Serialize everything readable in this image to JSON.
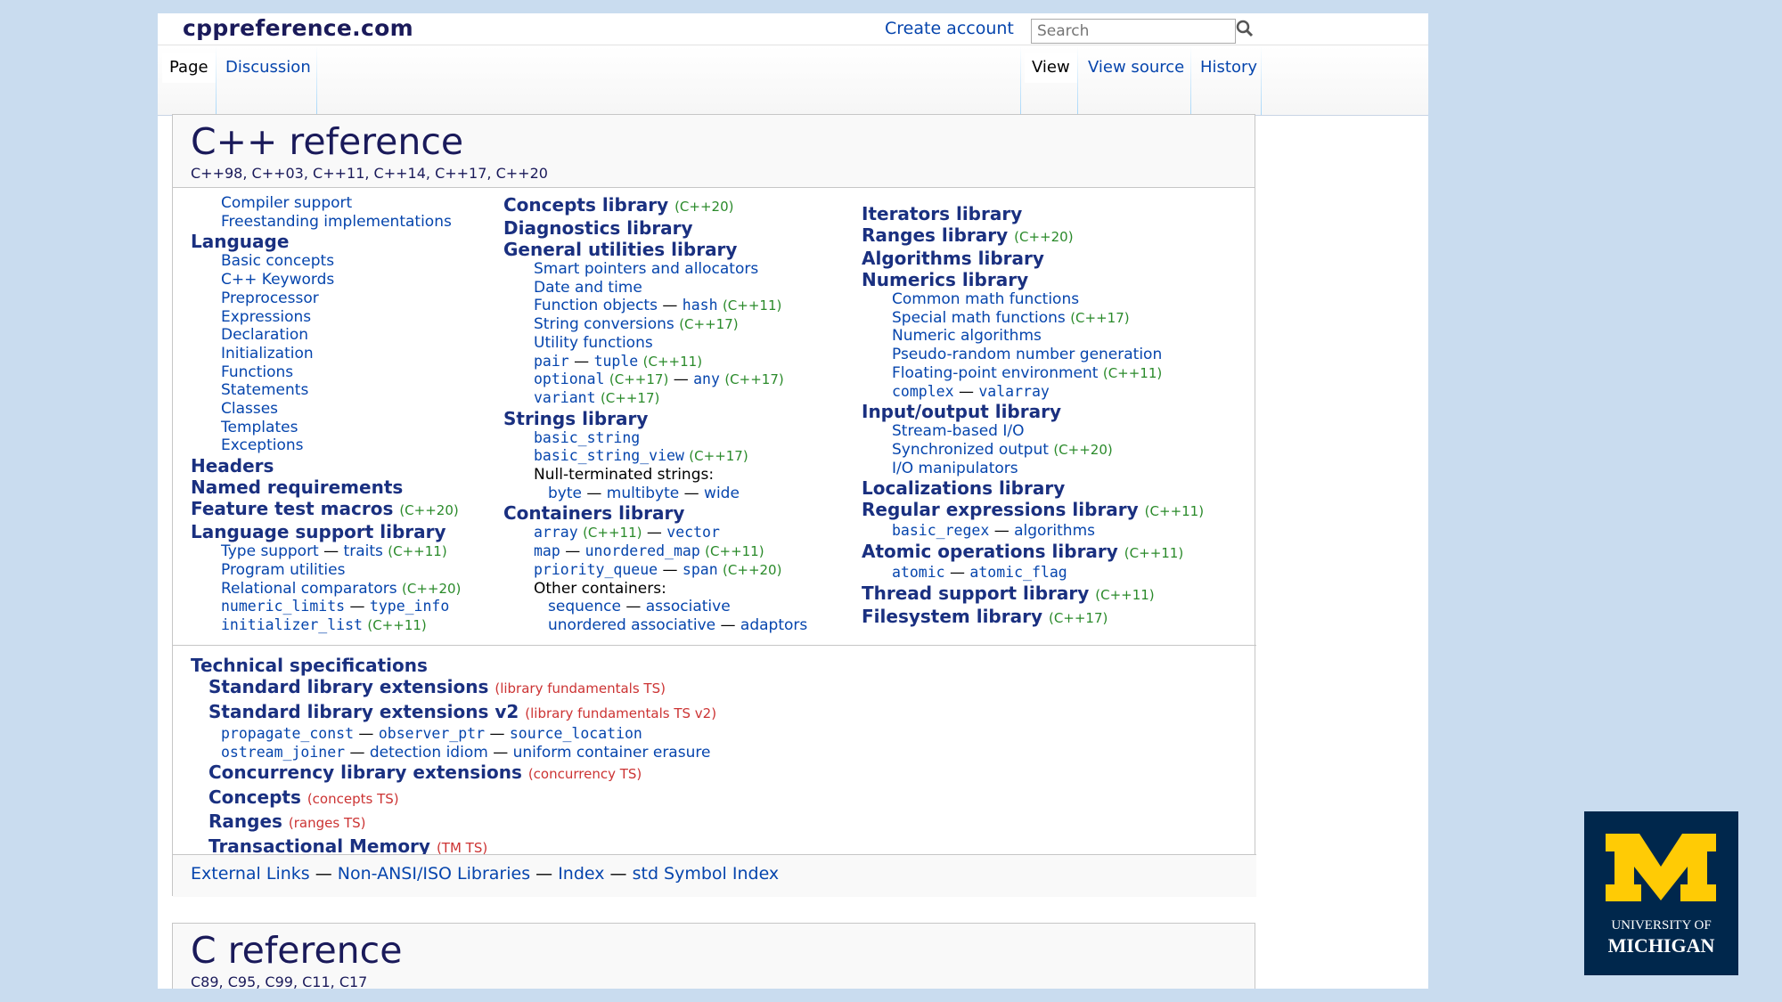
{
  "site": {
    "logo": "cppreference.com",
    "create_account": "Create account",
    "search_placeholder": "Search"
  },
  "tabs": {
    "page": "Page",
    "discussion": "Discussion",
    "view": "View",
    "view_source": "View source",
    "history": "History"
  },
  "cpp": {
    "title": "C++ reference",
    "versions": "C++98, C++03, C++11, C++14, C++17, C++20"
  },
  "col1": {
    "compiler_support": "Compiler support",
    "freestanding": "Freestanding implementations",
    "language": "Language",
    "language_items": [
      "Basic concepts",
      "C++ Keywords",
      "Preprocessor",
      "Expressions",
      "Declaration",
      "Initialization",
      "Functions",
      "Statements",
      "Classes",
      "Templates",
      "Exceptions"
    ],
    "headers": "Headers",
    "named_requirements": "Named requirements",
    "feature_test": "Feature test macros",
    "feature_test_ver": "(C++20)",
    "lang_support": "Language support library",
    "type_support": "Type support",
    "traits": "traits",
    "traits_ver": "(C++11)",
    "program_utilities": "Program utilities",
    "relational": "Relational comparators",
    "relational_ver": "(C++20)",
    "numeric_limits": "numeric_limits",
    "type_info": "type_info",
    "initializer_list": "initializer_list",
    "initializer_list_ver": "(C++11)"
  },
  "col2": {
    "concepts": "Concepts library",
    "concepts_ver": "(C++20)",
    "diagnostics": "Diagnostics library",
    "general": "General utilities library",
    "smart_pointers": "Smart pointers and allocators",
    "date_time": "Date and time",
    "function_objects": "Function objects",
    "hash": "hash",
    "hash_ver": "(C++11)",
    "string_conv": "String conversions",
    "string_conv_ver": "(C++17)",
    "utility": "Utility functions",
    "pair": "pair",
    "tuple": "tuple",
    "tuple_ver": "(C++11)",
    "optional": "optional",
    "optional_ver": "(C++17)",
    "any": "any",
    "any_ver": "(C++17)",
    "variant": "variant",
    "variant_ver": "(C++17)",
    "strings": "Strings library",
    "basic_string": "basic_string",
    "basic_string_view": "basic_string_view",
    "basic_string_view_ver": "(C++17)",
    "null_term": "Null-terminated strings:",
    "byte": "byte",
    "multibyte": "multibyte",
    "wide": "wide",
    "containers": "Containers library",
    "array": "array",
    "array_ver": "(C++11)",
    "vector": "vector",
    "map": "map",
    "unordered_map": "unordered_map",
    "unordered_map_ver": "(C++11)",
    "priority_queue": "priority_queue",
    "span": "span",
    "span_ver": "(C++20)",
    "other_containers": "Other containers:",
    "sequence": "sequence",
    "associative": "associative",
    "unordered_associative": "unordered associative",
    "adaptors": "adaptors"
  },
  "col3": {
    "iterators": "Iterators library",
    "ranges": "Ranges library",
    "ranges_ver": "(C++20)",
    "algorithms": "Algorithms library",
    "numerics": "Numerics library",
    "common_math": "Common math functions",
    "special_math": "Special math functions",
    "special_math_ver": "(C++17)",
    "numeric_alg": "Numeric algorithms",
    "prng": "Pseudo-random number generation",
    "fp_env": "Floating-point environment",
    "fp_env_ver": "(C++11)",
    "complex": "complex",
    "valarray": "valarray",
    "io": "Input/output library",
    "stream_io": "Stream-based I/O",
    "sync_output": "Synchronized output",
    "sync_output_ver": "(C++20)",
    "io_manip": "I/O manipulators",
    "localizations": "Localizations library",
    "regex": "Regular expressions library",
    "regex_ver": "(C++11)",
    "basic_regex": "basic_regex",
    "regex_algorithms": "algorithms",
    "atomic_ops": "Atomic operations library",
    "atomic_ops_ver": "(C++11)",
    "atomic": "atomic",
    "atomic_flag": "atomic_flag",
    "thread": "Thread support library",
    "thread_ver": "(C++11)",
    "filesystem": "Filesystem library",
    "filesystem_ver": "(C++17)"
  },
  "ts": {
    "title": "Technical specifications",
    "std_ext": "Standard library extensions",
    "std_ext_ts": "(library fundamentals TS)",
    "std_ext_v2": "Standard library extensions v2",
    "std_ext_v2_ts": "(library fundamentals TS v2)",
    "propagate_const": "propagate_const",
    "observer_ptr": "observer_ptr",
    "source_location": "source_location",
    "ostream_joiner": "ostream_joiner",
    "detection_idiom": "detection idiom",
    "uniform_erasure": "uniform container erasure",
    "concurrency": "Concurrency library extensions",
    "concurrency_ts": "(concurrency TS)",
    "concepts": "Concepts",
    "concepts_ts": "(concepts TS)",
    "ranges": "Ranges",
    "ranges_ts": "(ranges TS)",
    "tm": "Transactional Memory",
    "tm_ts": "(TM TS)"
  },
  "footer": {
    "external": "External Links",
    "non_ansi": "Non-ANSI/ISO Libraries",
    "index": "Index",
    "symbol_index": "std Symbol Index",
    "sep": "—"
  },
  "c": {
    "title": "C reference",
    "versions": "C89, C95, C99, C11, C17"
  },
  "logo_umich": {
    "line1": "UNIVERSITY OF",
    "line2": "MICHIGAN",
    "accent": "#ffcb05",
    "bg": "#00274c"
  }
}
